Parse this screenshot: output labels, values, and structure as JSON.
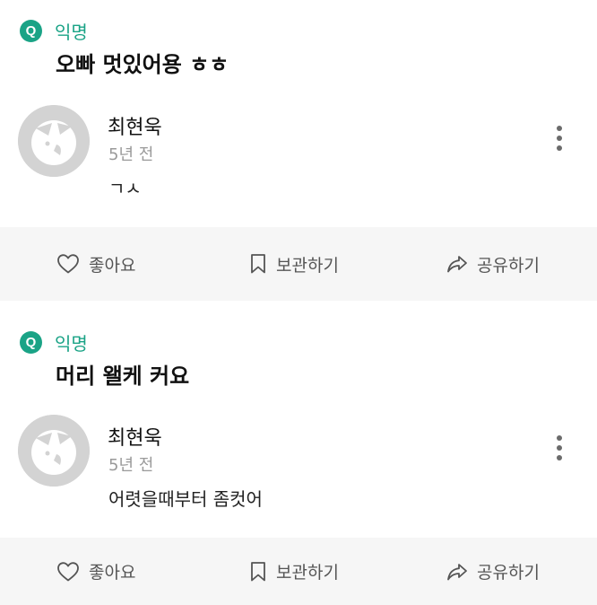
{
  "posts": [
    {
      "question": {
        "badge": "Q",
        "label": "익명",
        "text": "오빠 멋있어용 ㅎㅎ"
      },
      "answer": {
        "avatar_icon": "default-avatar-icon",
        "name": "최현욱",
        "time": "5년 전",
        "text": "ㄱㅅ",
        "more_icon": "more-vertical-icon"
      },
      "actions": {
        "like": {
          "label": "좋아요",
          "icon": "heart-icon"
        },
        "save": {
          "label": "보관하기",
          "icon": "bookmark-icon"
        },
        "share": {
          "label": "공유하기",
          "icon": "share-icon"
        }
      }
    },
    {
      "question": {
        "badge": "Q",
        "label": "익명",
        "text": "머리 왤케 커요"
      },
      "answer": {
        "avatar_icon": "default-avatar-icon",
        "name": "최현욱",
        "time": "5년 전",
        "text": "어렷을때부터 좀컷어",
        "more_icon": "more-vertical-icon"
      },
      "actions": {
        "like": {
          "label": "좋아요",
          "icon": "heart-icon"
        },
        "save": {
          "label": "보관하기",
          "icon": "bookmark-icon"
        },
        "share": {
          "label": "공유하기",
          "icon": "share-icon"
        }
      }
    }
  ],
  "colors": {
    "accent": "#1aa386",
    "action_bar_bg": "#f6f6f6",
    "muted_text": "#9a9a9a",
    "avatar_bg": "#d3d3d3"
  }
}
